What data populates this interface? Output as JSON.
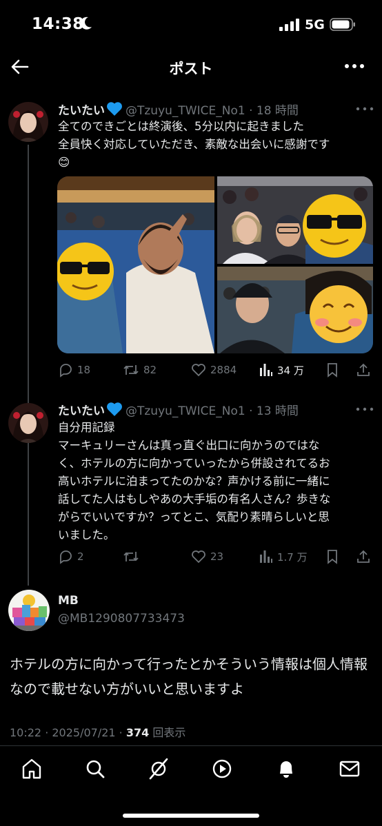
{
  "status_bar": {
    "time": "14:38",
    "network": "5G"
  },
  "header": {
    "title": "ポスト"
  },
  "tweets": [
    {
      "name": "たいたい",
      "handle": "@Tzuyu_TWICE_No1",
      "time": "18 時間",
      "text": "全てのできごとは終演後、5分以内に起きました\n全員快く対応していただき、素敵な出会いに感謝です\n😊",
      "actions": {
        "replies": "18",
        "retweets": "82",
        "likes": "2884",
        "views": "34 万"
      }
    },
    {
      "name": "たいたい",
      "handle": "@Tzuyu_TWICE_No1",
      "time": "13 時間",
      "text": "自分用記録\nマーキュリーさんは真っ直ぐ出口に向かうのではな\nく、ホテルの方に向かっていったから併設されてるお\n高いホテルに泊まってたのかな？声かける前に一緒に\n話してた人はもしやあの大手垢の有名人さん？歩きな\nがらでいいですか？ってとこ、気配り素晴らしいと思\nいました。",
      "actions": {
        "replies": "2",
        "retweets": "",
        "likes": "23",
        "views": "1.7 万"
      }
    }
  ],
  "reply": {
    "name": "MB",
    "handle": "@MB1290807733473",
    "text": "ホテルの方に向かって行ったとかそういう情報は個人情報なので載せない方がいいと思いますよ",
    "meta_prefix": "10:22 · 2025/07/21 · ",
    "view_count": "374",
    "view_label": " 回表示"
  },
  "icons": [
    "back-arrow-icon",
    "more-icon",
    "heart-icon",
    "reply-icon",
    "retweet-icon",
    "like-icon",
    "views-icon",
    "bookmark-icon",
    "share-icon",
    "home-icon",
    "search-icon",
    "grok-icon",
    "video-icon",
    "bell-icon",
    "mail-icon"
  ],
  "colors": {
    "background": "#000000",
    "text": "#e7e9ea",
    "muted": "#71767b",
    "verified_heart": "#1d9bf0"
  }
}
